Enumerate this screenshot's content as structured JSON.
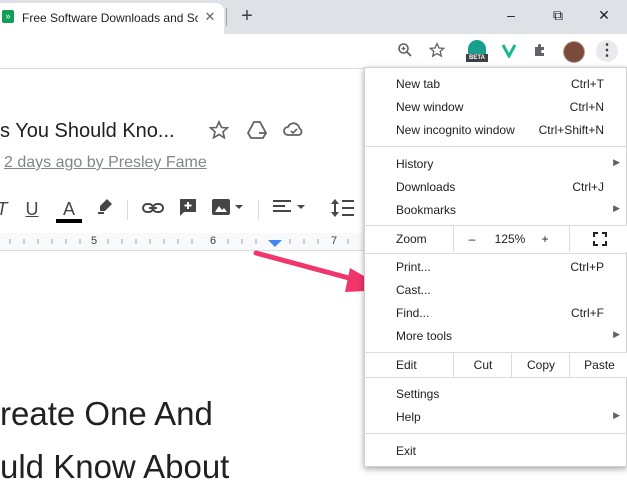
{
  "browser": {
    "tab_title": "Free Software Downloads and Software",
    "tab_close": "✕",
    "new_tab": "+",
    "window_controls": {
      "minimize": "–",
      "restore": "⧉",
      "close": "✕"
    },
    "toolbar": {
      "zoom_icon": "zoom-icon",
      "bookmark_icon": "star-icon",
      "beta_badge": "BETA",
      "vpn_icon": "v-shield-icon",
      "extensions_icon": "puzzle-icon",
      "menu_icon": "⋮"
    }
  },
  "docs": {
    "title_fragment": "s You Should Kno...",
    "last_edit": "2 days ago by Presley Fame",
    "format_toolbar": {
      "italic": "T",
      "underline": "U",
      "text_color": "A",
      "text_color_bar": "#000000"
    },
    "ruler_numbers": [
      "5",
      "6",
      "7"
    ],
    "body_line1": "reate One And",
    "body_line2": "uld Know About"
  },
  "menu": {
    "items_top": [
      {
        "label": "New tab",
        "shortcut": "Ctrl+T"
      },
      {
        "label": "New window",
        "shortcut": "Ctrl+N"
      },
      {
        "label": "New incognito window",
        "shortcut": "Ctrl+Shift+N"
      }
    ],
    "items_mid": [
      {
        "label": "History",
        "submenu": "▶"
      },
      {
        "label": "Downloads",
        "shortcut": "Ctrl+J"
      },
      {
        "label": "Bookmarks",
        "submenu": "▶"
      }
    ],
    "zoom": {
      "label": "Zoom",
      "minus": "–",
      "value": "125%",
      "plus": "+",
      "fullscreen": "⛶"
    },
    "items_tools": [
      {
        "label": "Print...",
        "shortcut": "Ctrl+P"
      },
      {
        "label": "Cast..."
      },
      {
        "label": "Find...",
        "shortcut": "Ctrl+F"
      },
      {
        "label": "More tools",
        "submenu": "▶"
      }
    ],
    "edit": {
      "label": "Edit",
      "cut": "Cut",
      "copy": "Copy",
      "paste": "Paste"
    },
    "items_bottom": [
      {
        "label": "Settings"
      },
      {
        "label": "Help",
        "submenu": "▶"
      }
    ],
    "exit": {
      "label": "Exit"
    }
  },
  "colors": {
    "arrow": "#f0366a",
    "tab_strip": "#dee1e6",
    "favicon": "#0f9d58",
    "ruler_marker": "#4285f4"
  }
}
